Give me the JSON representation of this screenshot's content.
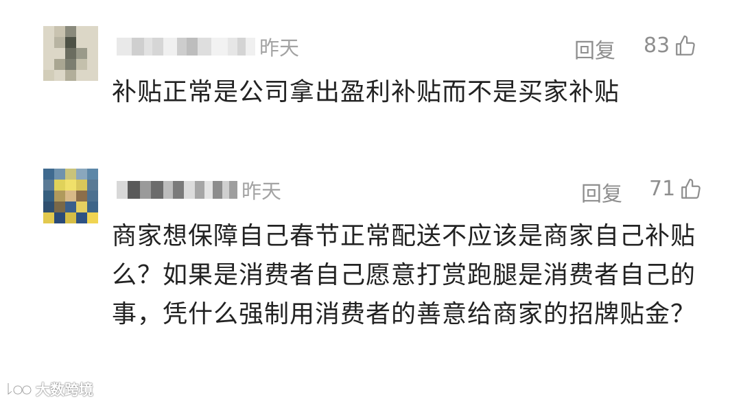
{
  "comments": [
    {
      "time": "昨天",
      "reply_label": "回复",
      "likes": "83",
      "text": "补贴正常是公司拿出盈利补贴而不是买家补贴"
    },
    {
      "time": "昨天",
      "reply_label": "回复",
      "likes": "71",
      "text": "商家想保障自己春节正常配送不应该是商家自己补贴么？如果是消费者自己愿意打赏跑腿是消费者自己的事，凭什么强制用消费者的善意给商家的招牌贴金？"
    }
  ],
  "watermark": {
    "text": "大数跨境"
  },
  "icons": {
    "like": "thumbs-up-icon",
    "watermark_logo": "logo-icon"
  },
  "colors": {
    "meta_gray": "#8e8e8e",
    "text": "#222222",
    "background": "#ffffff"
  }
}
